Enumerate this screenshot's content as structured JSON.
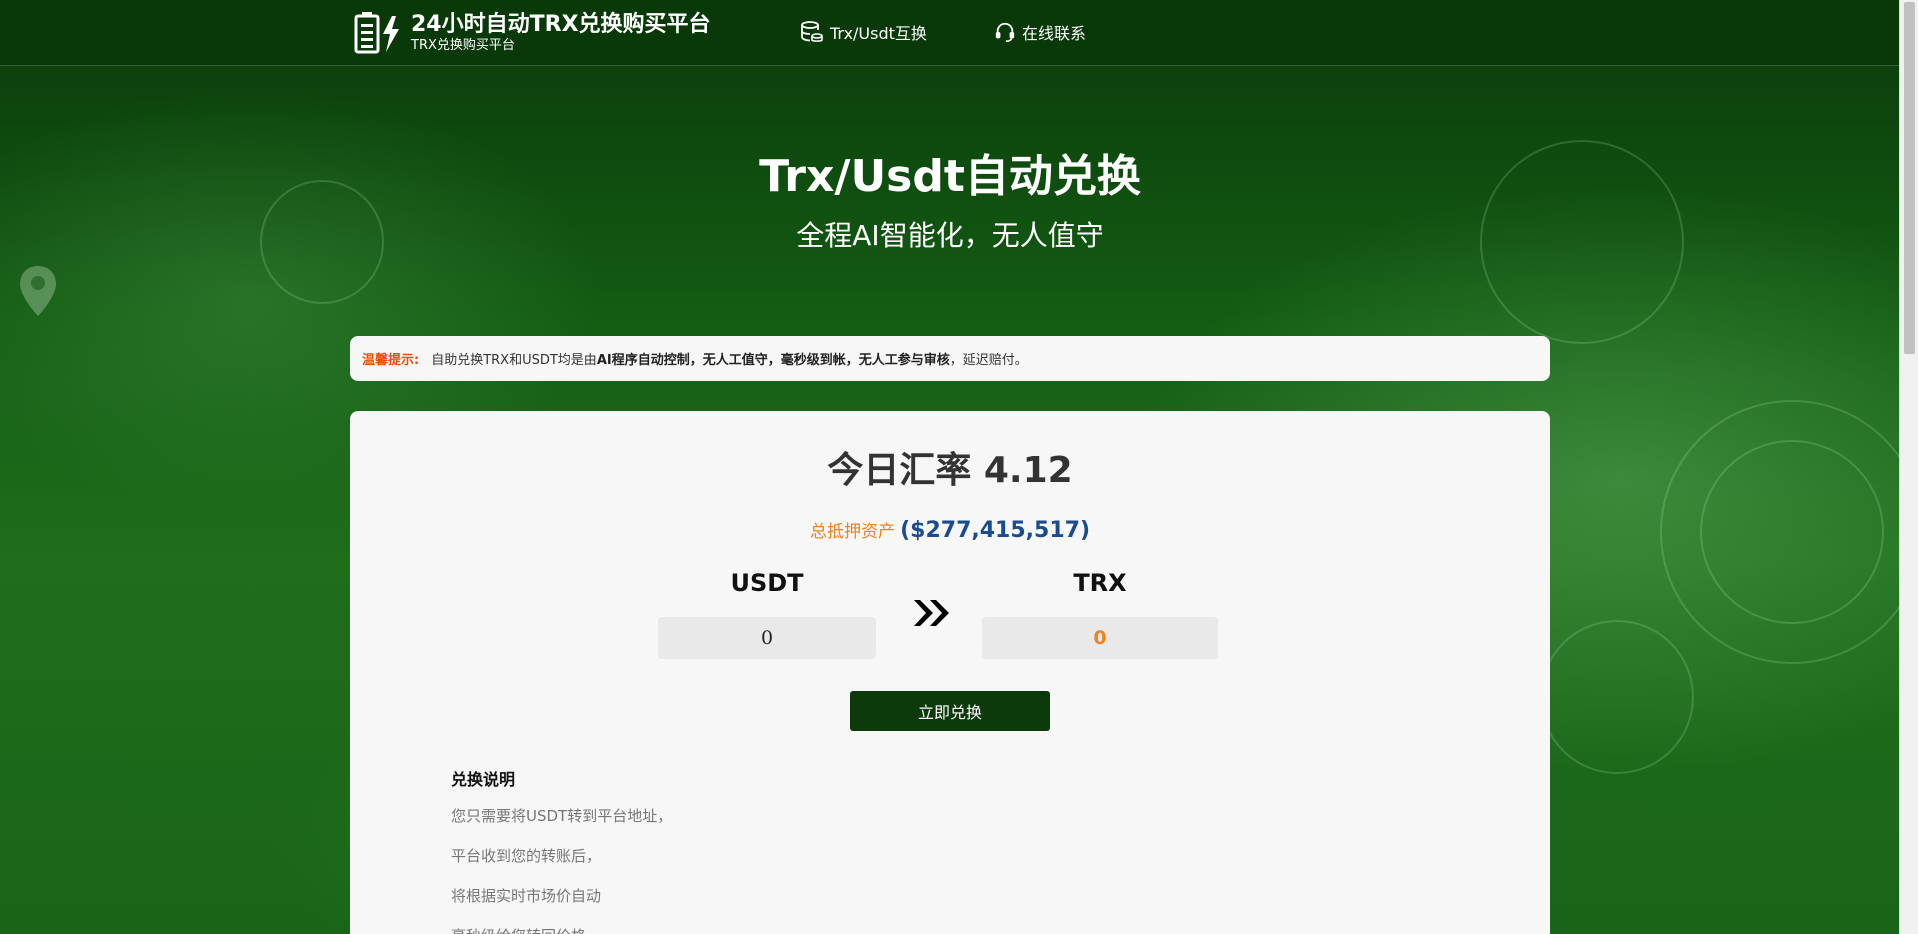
{
  "header": {
    "title": "24小时自动TRX兑换购买平台",
    "subtitle": "TRX兑换购买平台",
    "nav": [
      {
        "label": "Trx/Usdt互换",
        "icon": "database-icon"
      },
      {
        "label": "在线联系",
        "icon": "headset-icon"
      }
    ]
  },
  "hero": {
    "title": "Trx/Usdt自动兑换",
    "subtitle": "全程AI智能化，无人值守"
  },
  "notice": {
    "label": "温馨提示:",
    "text_a": "自助兑换TRX和USDT均是由",
    "text_b": "AI程序自动控制，无人工值守，毫秒级到帐，无人工参与审核",
    "text_c": "，延迟赔付。"
  },
  "exchange": {
    "rate_text": "今日汇率 4.12",
    "assets_label": "总抵押资产",
    "assets_value": "($277,415,517)",
    "from_label": "USDT",
    "from_value": "0",
    "to_label": "TRX",
    "to_value": "0",
    "button_label": "立即兑换"
  },
  "info": {
    "title": "兑换说明",
    "lines": [
      "您只需要将USDT转到平台地址，",
      "平台收到您的转账后，",
      "将根据实时市场价自动",
      "毫秒级给您转回价格"
    ]
  },
  "colors": {
    "header_bg": "#093909",
    "button_bg": "#0c3a0a",
    "notice_label": "#e8500a",
    "assets_label": "#f0821e",
    "assets_value": "#1a4d8f"
  }
}
